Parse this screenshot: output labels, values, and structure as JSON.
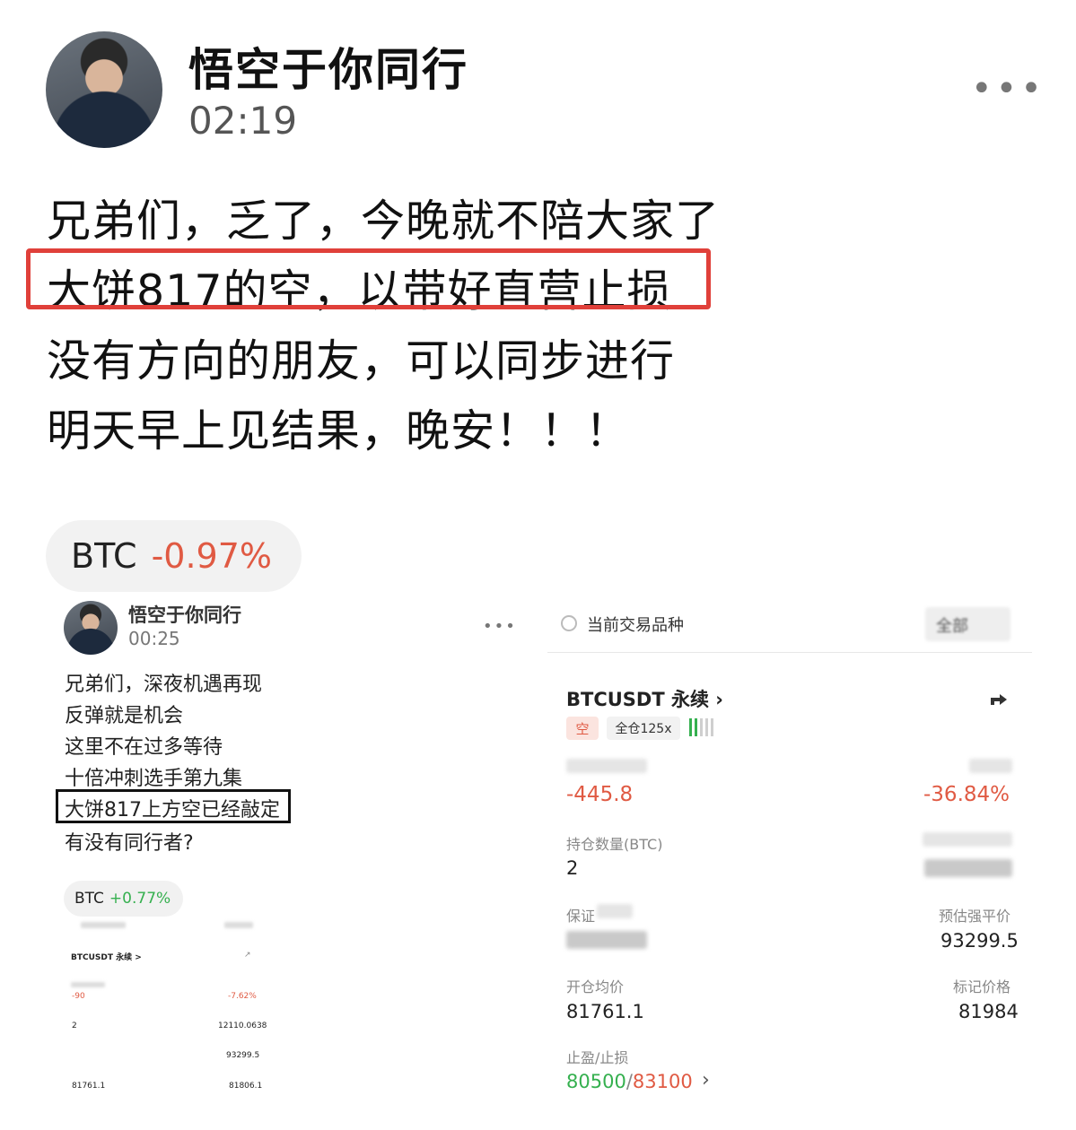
{
  "post": {
    "author": "悟空于你同行",
    "time": "02:19",
    "more": "•••",
    "lines": [
      "兄弟们，乏了，今晚就不陪大家了",
      "大饼817的空，以带好直营止损",
      "没有方向的朋友，可以同步进行",
      "明天早上见结果，晚安！！！"
    ],
    "ticker": {
      "symbol": "BTC",
      "change": "-0.97%"
    }
  },
  "embedded_post": {
    "author": "悟空于你同行",
    "time": "00:25",
    "more": "•••",
    "lines": [
      "兄弟们，深夜机遇再现",
      "反弹就是机会",
      "这里不在过多等待",
      "十倍冲刺选手第九集",
      "大饼817上方空已经敲定",
      "有没有同行者?"
    ],
    "ticker": {
      "symbol": "BTC",
      "change": "+0.77%"
    },
    "mini": {
      "contract": "BTCUSDT 永续 >",
      "pnl": "-90",
      "roi": "-7.62%",
      "qty": "2",
      "mid_right": "12110.0638",
      "liq": "93299.5",
      "entry": "81761.1",
      "mark": "81806.1"
    }
  },
  "position_panel": {
    "filter_label": "当前交易品种",
    "filter_button": "全部",
    "contract": "BTCUSDT 永续 ›",
    "side_tag": "空",
    "margin_tag": "全仓125x",
    "pnl": "-445.8",
    "roi": "-36.84%",
    "qty_label": "持仓数量(BTC)",
    "qty": "2",
    "margin_label": "保证",
    "liq_label": "预估强平价",
    "liq_price": "93299.5",
    "entry_label": "开仓均价",
    "entry_price": "81761.1",
    "mark_label": "标记价格",
    "mark_price": "81984",
    "tpsl_label": "止盈/止损",
    "tp": "80500",
    "sep": "/",
    "sl": "83100",
    "chevron": "›"
  },
  "colors": {
    "red": "#e05a43",
    "green": "#35b04f",
    "highlight_border": "#e0403a"
  },
  "icons": [
    "more-horizontal-icon",
    "radio-icon",
    "share-icon",
    "signal-bars-icon",
    "chevron-right-icon"
  ]
}
